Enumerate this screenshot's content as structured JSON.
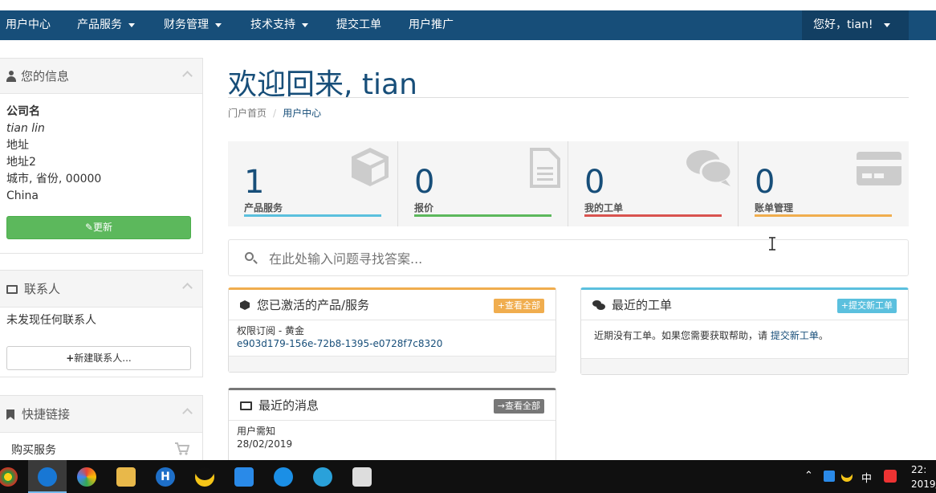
{
  "nav": {
    "items": [
      {
        "label": "用户中心",
        "dropdown": false
      },
      {
        "label": "产品服务",
        "dropdown": true
      },
      {
        "label": "财务管理",
        "dropdown": true
      },
      {
        "label": "技术支持",
        "dropdown": true
      },
      {
        "label": "提交工单",
        "dropdown": false
      },
      {
        "label": "用户推广",
        "dropdown": false
      }
    ],
    "user_greeting": "您好，tian!"
  },
  "sidebar": {
    "info": {
      "title": "您的信息",
      "company": "公司名",
      "name": "tian lin",
      "address1": "地址",
      "address2": "地址2",
      "city_line": "城市, 省份, 00000",
      "country": "China",
      "update_button": "更新"
    },
    "contacts": {
      "title": "联系人",
      "empty_text": "未发现任何联系人",
      "new_button": "新建联系人..."
    },
    "shortcuts": {
      "title": "快捷链接",
      "items": [
        {
          "label": "购买服务"
        }
      ]
    }
  },
  "main": {
    "title": "欢迎回来, tian",
    "breadcrumb": {
      "home": "门户首页",
      "separator": "/",
      "current": "用户中心"
    },
    "stats": [
      {
        "value": "1",
        "label": "产品服务",
        "color": "#5bc0de",
        "icon": "cube-icon"
      },
      {
        "value": "0",
        "label": "报价",
        "color": "#5cb85c",
        "icon": "file-icon"
      },
      {
        "value": "0",
        "label": "我的工单",
        "color": "#d9534f",
        "icon": "comments-icon"
      },
      {
        "value": "0",
        "label": "账单管理",
        "color": "#f0ad4e",
        "icon": "credit-card-icon"
      }
    ],
    "search_placeholder": "在此处输入问题寻找答案...",
    "products_card": {
      "title": "您已激活的产品/服务",
      "action": "+查看全部",
      "accent": "#f0ad4e",
      "item_name": "权限订阅 - 黄金",
      "item_id": "e903d179-156e-72b8-1395-e0728f7c8320"
    },
    "tickets_card": {
      "title": "最近的工单",
      "action": "+提交新工单",
      "accent": "#5bc0de",
      "empty_text": "近期没有工单。如果您需要获取帮助，请",
      "link": "提交新工单",
      "suffix": "。"
    },
    "news_card": {
      "title": "最近的消息",
      "action": "→查看全部",
      "accent": "#777777",
      "item_title": "用户需知",
      "item_date": "28/02/2019"
    }
  },
  "taskbar": {
    "tray_ime": "中",
    "clock_time": "22:",
    "clock_date": "2019/"
  }
}
